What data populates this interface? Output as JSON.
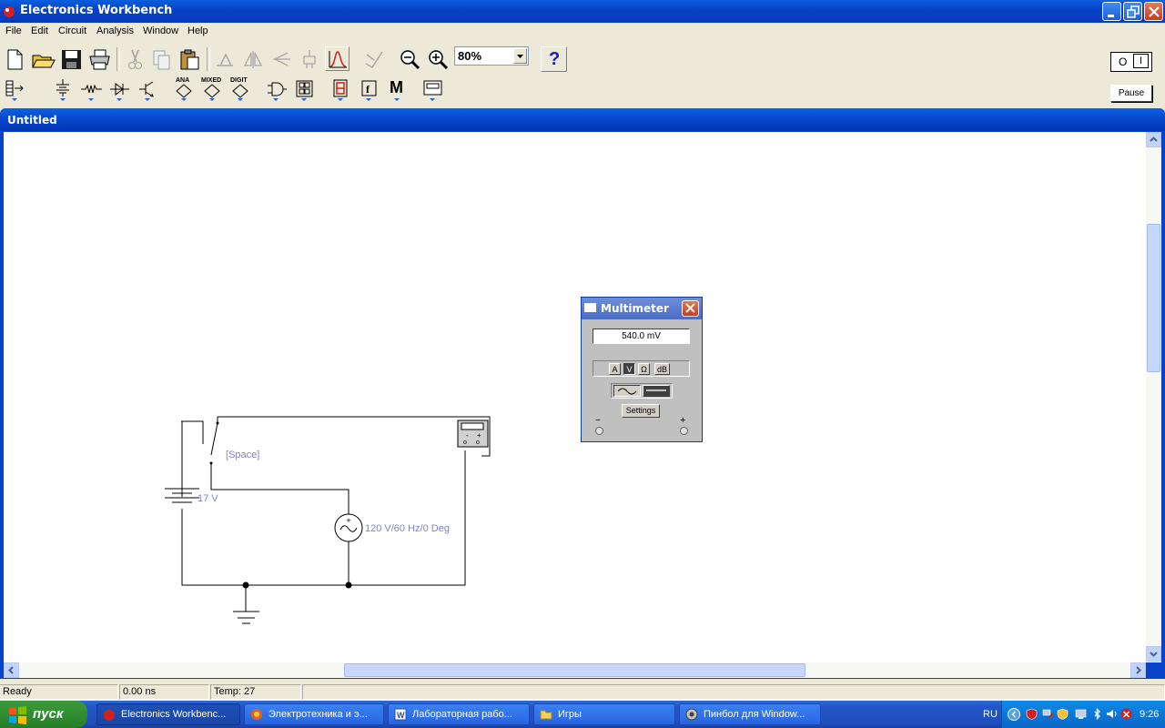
{
  "app": {
    "title": "Electronics Workbench"
  },
  "menu": [
    "File",
    "Edit",
    "Circuit",
    "Analysis",
    "Window",
    "Help"
  ],
  "toolbar": {
    "zoom_value": "80%",
    "help_label": "?"
  },
  "sim_control": {
    "pause_label": "Pause",
    "power_on": "O",
    "power_off": "I"
  },
  "parts_bin": [
    "ANA",
    "MIXED",
    "DIGIT",
    "M"
  ],
  "document": {
    "title": "Untitled"
  },
  "circuit": {
    "switch_key": "[Space]",
    "battery_label": "17 V",
    "ac_source_label": "120 V/60 Hz/0 Deg"
  },
  "multimeter": {
    "title": "Multimeter",
    "display": "540.0   mV",
    "modes": [
      "A",
      "V",
      "Ω",
      "dB"
    ],
    "active_mode": "V",
    "settings_label": "Settings",
    "minus": "−",
    "plus": "+"
  },
  "status": {
    "state": "Ready",
    "time": "0.00 ns",
    "temp": "Temp:  27"
  },
  "taskbar": {
    "start_label": "пуск",
    "tasks": [
      "Electronics Workbenc...",
      "Электротехника и э...",
      "Лабораторная рабо...",
      "Игры",
      "Пинбол для Window..."
    ],
    "language": "RU",
    "clock": "9:26"
  }
}
